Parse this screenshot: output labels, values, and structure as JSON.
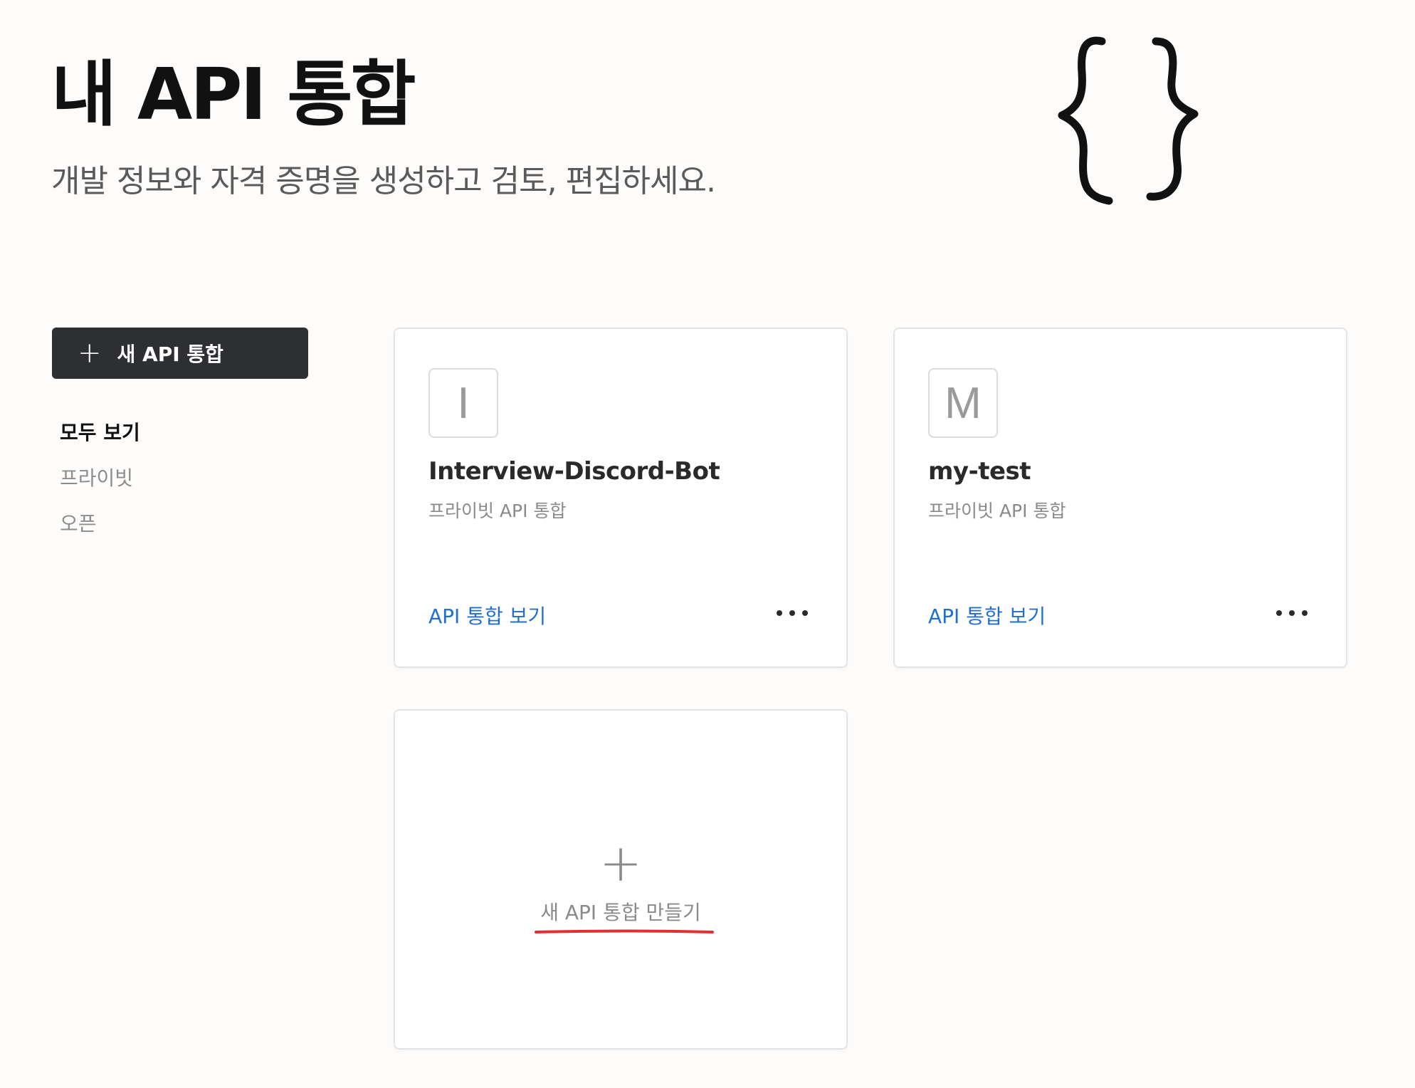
{
  "header": {
    "title": "내 API 통합",
    "subtitle": "개발 정보와 자격 증명을 생성하고 검토, 편집하세요."
  },
  "sidebar": {
    "new_button": {
      "icon": "plus-icon",
      "label": "새 API 통합"
    },
    "filters": [
      {
        "label": "모두 보기",
        "active": true
      },
      {
        "label": "프라이빗",
        "active": false
      },
      {
        "label": "오픈",
        "active": false
      }
    ]
  },
  "integrations": [
    {
      "initial": "I",
      "name": "Interview-Discord-Bot",
      "type": "프라이빗 API 통합",
      "link": "API 통합 보기",
      "menu_icon": "more-horizontal-icon"
    },
    {
      "initial": "M",
      "name": "my-test",
      "type": "프라이빗 API 통합",
      "link": "API 통합 보기",
      "menu_icon": "more-horizontal-icon"
    }
  ],
  "create_card": {
    "icon": "plus-icon",
    "label": "새 API 통합 만들기"
  },
  "decor": {
    "illustration": "curly-braces-icon",
    "annotation_color": "#e03131"
  },
  "colors": {
    "button_bg": "#2d2f33",
    "link": "#1f6fd1",
    "page_bg": "#fdfcfb"
  }
}
